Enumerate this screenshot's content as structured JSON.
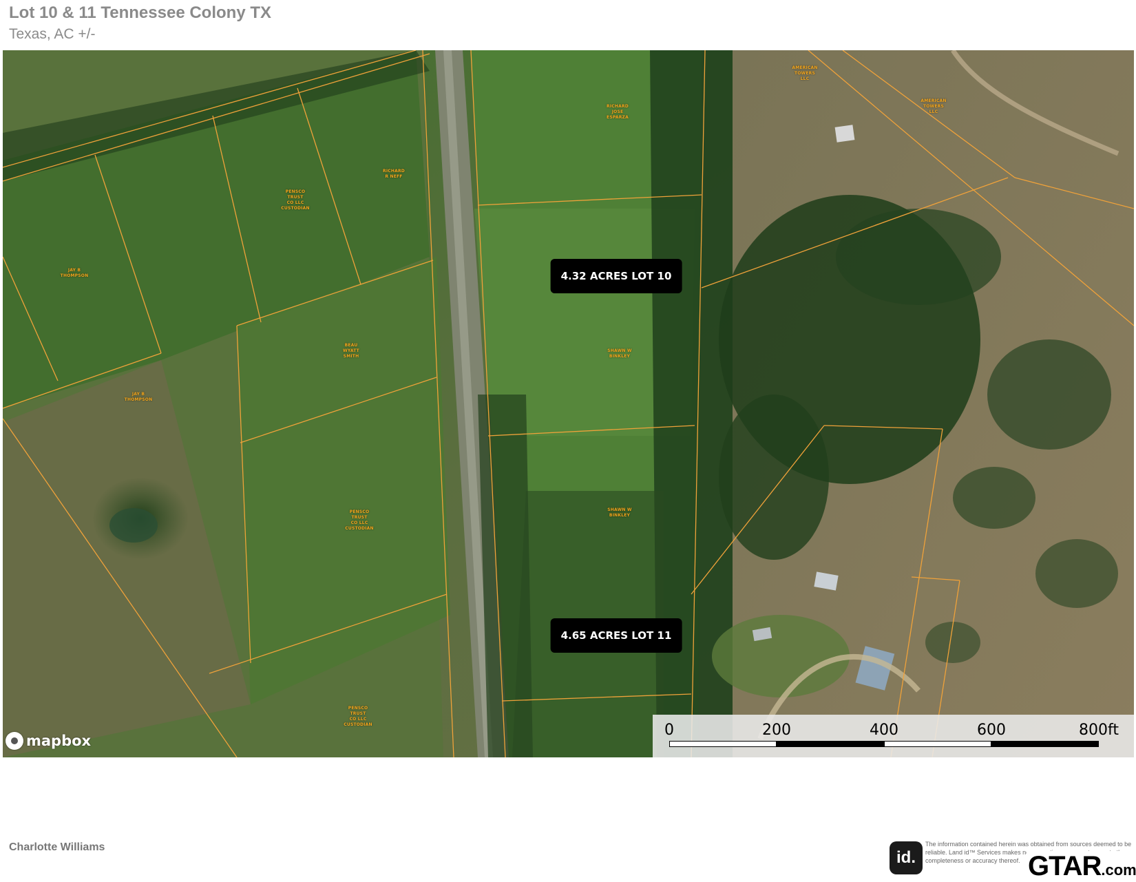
{
  "header": {
    "title": "Lot 10 & 11 Tennessee Colony TX",
    "subtitle": "Texas,  AC +/-"
  },
  "map": {
    "type": "satellite parcel map",
    "colors": {
      "parcel_line": "#f0a23a",
      "owner_label": "#f3a51c",
      "lot_label_bg": "#000000",
      "lot_label_text": "#ffffff"
    },
    "owner_labels": [
      {
        "id": "richard-jose-esparza",
        "text": "RICHARD\nJOSE\nESPARZA"
      },
      {
        "id": "richard-r-neff",
        "text": "RICHARD\nR NEFF"
      },
      {
        "id": "pensco-1",
        "text": "PENSCO\nTRUST\nCO LLC\nCUSTODIAN"
      },
      {
        "id": "jay-b-thompson-1",
        "text": "JAY B\nTHOMPSON"
      },
      {
        "id": "beau-wyatt-smith",
        "text": "BEAU\nWYATT\nSMITH"
      },
      {
        "id": "jay-b-thompson-2",
        "text": "JAY B\nTHOMPSON"
      },
      {
        "id": "shawn-w-binkley-1",
        "text": "SHAWN W\nBINKLEY"
      },
      {
        "id": "shawn-w-binkley-2",
        "text": "SHAWN W\nBINKLEY"
      },
      {
        "id": "pensco-2",
        "text": "PENSCO\nTRUST\nCO LLC\nCUSTODIAN"
      },
      {
        "id": "pensco-3",
        "text": "PENSCO\nTRUST\nCO LLC\nCUSTODIAN"
      },
      {
        "id": "american-towers-1",
        "text": "AMERICAN\nTOWERS\nLLC"
      },
      {
        "id": "american-towers-2",
        "text": "AMERICAN\nTOWERS\nLLC"
      }
    ],
    "lot_labels": [
      {
        "id": "lot-10",
        "text": "4.32 ACRES LOT 10"
      },
      {
        "id": "lot-11",
        "text": "4.65 ACRES LOT 11"
      }
    ],
    "attribution": "mapbox",
    "scale": {
      "ticks": [
        "0",
        "200",
        "400",
        "600",
        "800ft"
      ]
    }
  },
  "footer": {
    "agent": "Charlotte  Williams",
    "landid_logo": "id.",
    "disclaimer": "The information contained herein was obtained from sources deemed to be reliable. Land id™ Services makes no warranties or guarantees as to the completeness or accuracy thereof.",
    "gtar_logo": "GTAR",
    "gtar_suffix": ".com"
  }
}
